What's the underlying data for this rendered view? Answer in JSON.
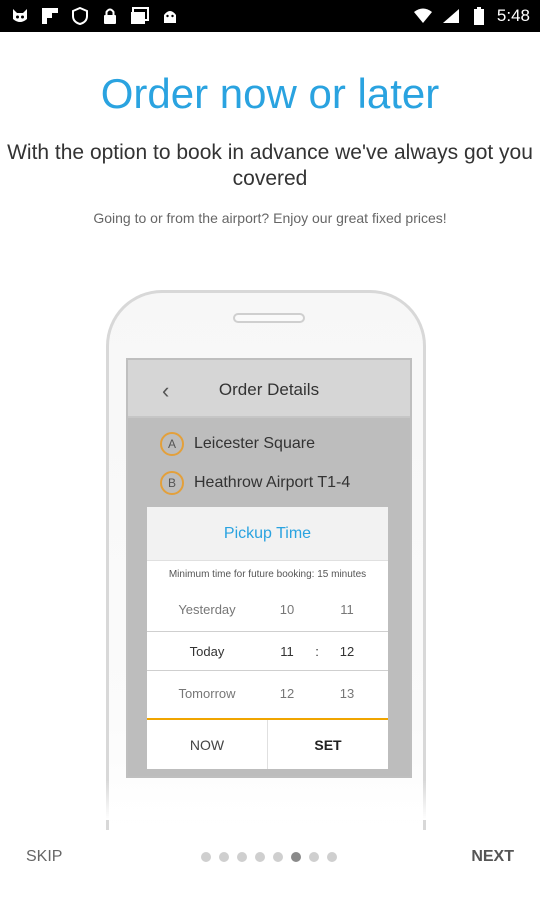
{
  "status_bar": {
    "time": "5:48",
    "icons": [
      "cat-face-icon",
      "flipboard-icon",
      "shield-icon",
      "lock-icon",
      "photos-icon",
      "android-icon"
    ],
    "right_icons": [
      "wifi-icon",
      "signal-icon",
      "battery-icon"
    ]
  },
  "onboarding": {
    "title": "Order now or later",
    "subtitle": "With the option to book in advance we've always got you covered",
    "caption": "Going to or from the airport? Enjoy our great fixed prices!"
  },
  "illustration": {
    "header_title": "Order Details",
    "locations": [
      {
        "badge": "A",
        "text": "Leicester Square"
      },
      {
        "badge": "B",
        "text": "Heathrow Airport T1-4"
      }
    ],
    "pickup": {
      "title": "Pickup Time",
      "note": "Minimum time for future booking: 15 minutes",
      "rows": [
        {
          "day": "Yesterday",
          "hour": "10",
          "minute": "11"
        },
        {
          "day": "Today",
          "hour": "11",
          "sep": ":",
          "minute": "12"
        },
        {
          "day": "Tomorrow",
          "hour": "12",
          "minute": "13"
        }
      ],
      "now_label": "NOW",
      "set_label": "SET"
    }
  },
  "footer": {
    "skip_label": "SKIP",
    "next_label": "NEXT",
    "page_count": 8,
    "active_index": 5
  },
  "colors": {
    "accent_blue": "#2aa3e0",
    "accent_orange": "#f0a500"
  }
}
